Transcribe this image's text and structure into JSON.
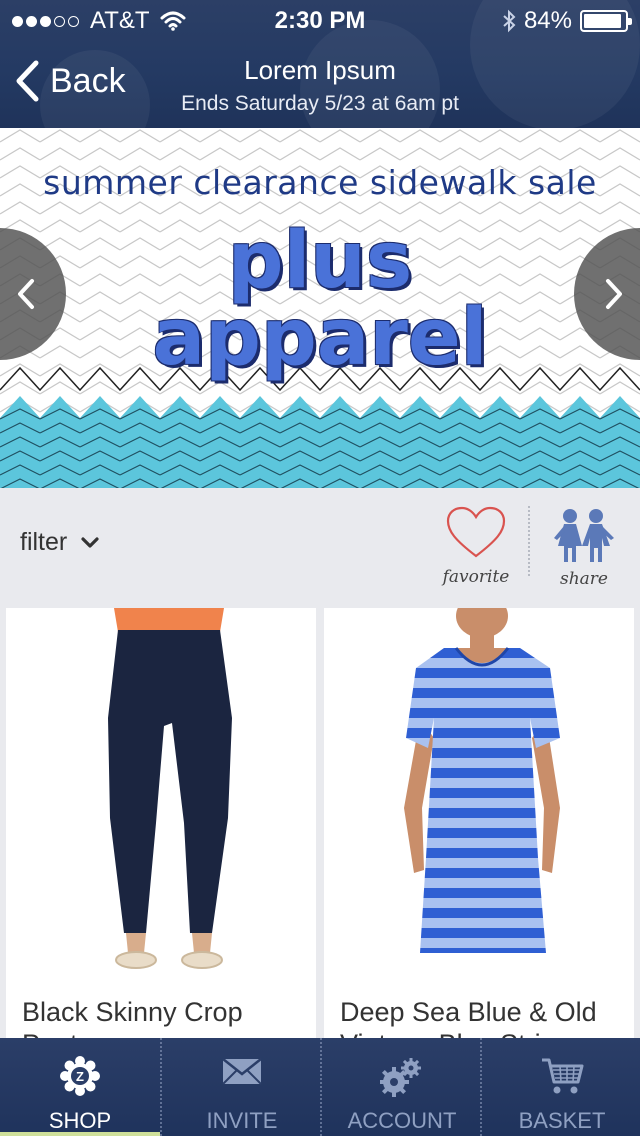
{
  "status_bar": {
    "carrier": "AT&T",
    "time": "2:30 PM",
    "battery": "84%",
    "signal_bars_filled": 3,
    "signal_bars_total": 5
  },
  "nav": {
    "back_label": "Back",
    "title": "Lorem Ipsum",
    "subtitle": "Ends Saturday 5/23 at 6am pt"
  },
  "banner": {
    "headline": "summer clearance sidewalk sale",
    "line1": "plus",
    "line2": "apparel",
    "accent_color": "#4a72d8",
    "wave_color": "#5cc6dc"
  },
  "toolbar": {
    "filter_label": "filter",
    "favorite_label": "favorite",
    "share_label": "share"
  },
  "products": [
    {
      "name": "Black Skinny Crop Pants"
    },
    {
      "name": "Deep Sea Blue & Old Vintage Blue Stripe"
    }
  ],
  "tabs": [
    {
      "label": "SHOP",
      "icon": "shop-icon",
      "active": true
    },
    {
      "label": "INVITE",
      "icon": "envelope-icon",
      "active": false
    },
    {
      "label": "ACCOUNT",
      "icon": "gears-icon",
      "active": false
    },
    {
      "label": "BASKET",
      "icon": "basket-icon",
      "active": false
    }
  ]
}
